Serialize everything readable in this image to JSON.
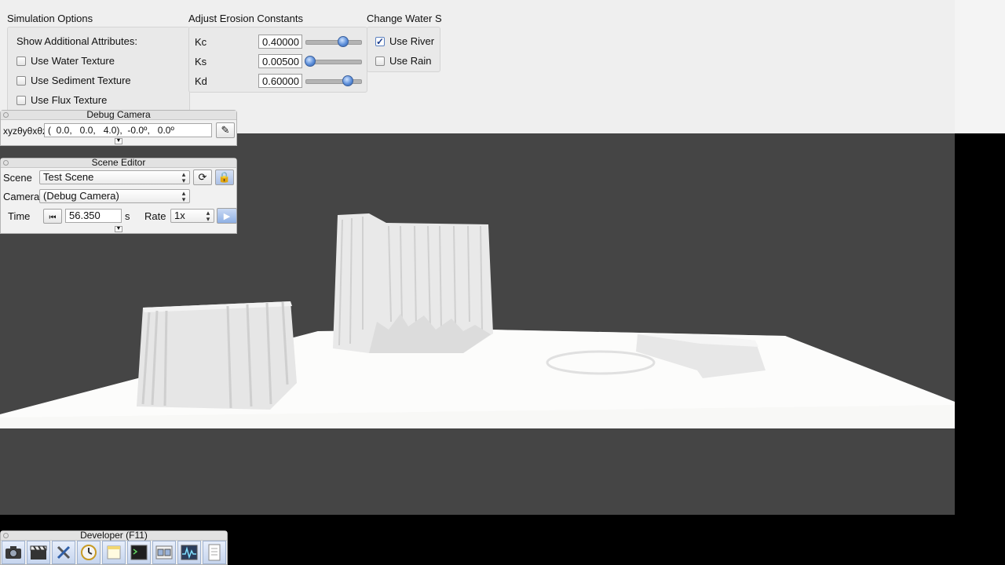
{
  "simulation_options": {
    "title": "Simulation Options",
    "show_attributes_label": "Show Additional Attributes:",
    "checkboxes": [
      {
        "label": "Use Water Texture",
        "checked": false
      },
      {
        "label": "Use Sediment Texture",
        "checked": false
      },
      {
        "label": "Use Flux Texture",
        "checked": false
      }
    ]
  },
  "erosion_constants": {
    "title": "Adjust Erosion Constants",
    "rows": [
      {
        "label": "Kc",
        "value": "0.40000",
        "slider_fraction": 0.68
      },
      {
        "label": "Ks",
        "value": "0.00500",
        "slider_fraction": 0.08
      },
      {
        "label": "Kd",
        "value": "0.60000",
        "slider_fraction": 0.77
      }
    ]
  },
  "water_source": {
    "title": "Change Water S",
    "checkboxes": [
      {
        "label": "Use River",
        "checked": true
      },
      {
        "label": "Use Rain",
        "checked": false
      }
    ]
  },
  "debug_camera": {
    "title": "Debug Camera",
    "coord_label": "xyzθyθxθz",
    "coord_value": "(  0.0,   0.0,   4.0),  -0.0º,   0.0º"
  },
  "scene_editor": {
    "title": "Scene Editor",
    "scene_label": "Scene",
    "scene_value": "Test Scene",
    "camera_label": "Camera",
    "camera_value": "(Debug Camera)",
    "time_label": "Time",
    "time_value": "56.350",
    "time_unit": "s",
    "rate_label": "Rate",
    "rate_value": "1x"
  },
  "developer": {
    "title": "Developer (F11)",
    "icons": [
      "camera-icon",
      "film-clapper-icon",
      "tools-icon",
      "clock-icon",
      "note-icon",
      "terminal-icon",
      "windows-icon",
      "profiler-icon",
      "document-icon"
    ]
  },
  "colors": {
    "viewport_bg": "#454545",
    "terrain": "#f7f7f5",
    "accent": "#3f6fc0"
  }
}
